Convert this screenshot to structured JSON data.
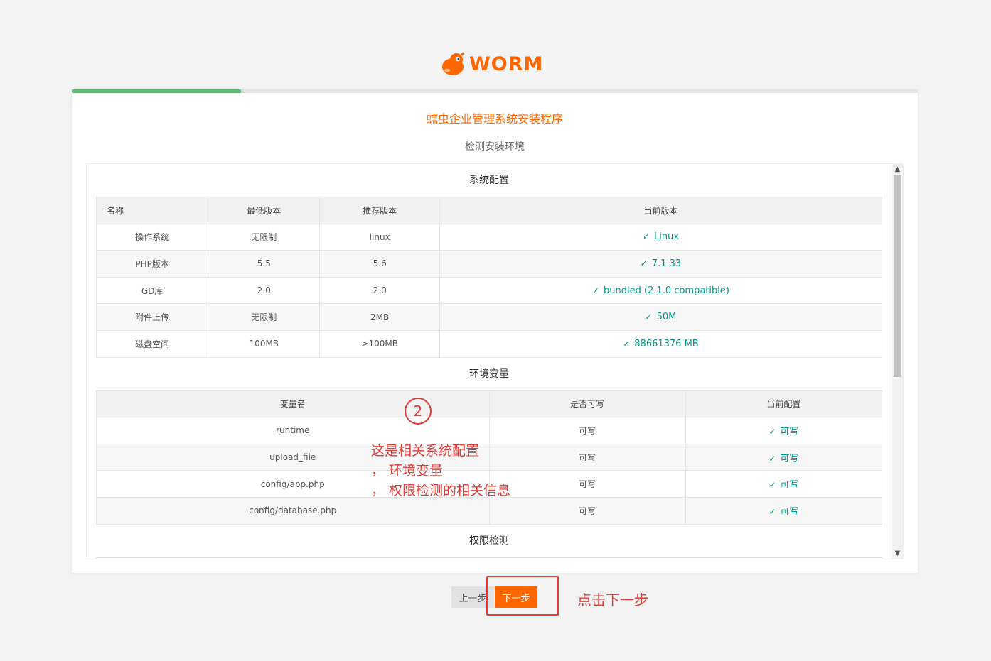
{
  "logo": {
    "text": "WORM"
  },
  "progress": {
    "fraction": 0.2
  },
  "header": {
    "title": "蠕虫企业管理系统安装程序",
    "subtitle": "检测安装环境"
  },
  "system": {
    "title": "系统配置",
    "columns": [
      "名称",
      "最低版本",
      "推荐版本",
      "当前版本"
    ],
    "rows": [
      {
        "name": "操作系统",
        "min": "无限制",
        "rec": "linux",
        "cur": "Linux"
      },
      {
        "name": "PHP版本",
        "min": "5.5",
        "rec": "5.6",
        "cur": "7.1.33"
      },
      {
        "name": "GD库",
        "min": "2.0",
        "rec": "2.0",
        "cur": "bundled (2.1.0 compatible)"
      },
      {
        "name": "附件上传",
        "min": "无限制",
        "rec": "2MB",
        "cur": "50M"
      },
      {
        "name": "磁盘空间",
        "min": "100MB",
        "rec": ">100MB",
        "cur": "88661376 MB"
      }
    ]
  },
  "env": {
    "title": "环境变量",
    "columns": [
      "变量名",
      "是否可写",
      "当前配置"
    ],
    "rows": [
      {
        "name": "runtime",
        "writable": "可写",
        "cur": "可写"
      },
      {
        "name": "upload_file",
        "writable": "可写",
        "cur": "可写"
      },
      {
        "name": "config/app.php",
        "writable": "可写",
        "cur": "可写"
      },
      {
        "name": "config/database.php",
        "writable": "可写",
        "cur": "可写"
      }
    ]
  },
  "perm": {
    "title": "权限检测"
  },
  "check_symbol": "✓",
  "buttons": {
    "prev": "上一步",
    "next": "下一步"
  },
  "annotations": {
    "step_number": "2",
    "line1": "这是相关系统配置",
    "line2": "，  环境变量",
    "line3": "，  权限检测的相关信息",
    "click_hint": "点击下一步"
  },
  "colors": {
    "accent": "#ff6600",
    "success": "#009688",
    "progress": "#5fb878",
    "annotation": "#e53935"
  }
}
